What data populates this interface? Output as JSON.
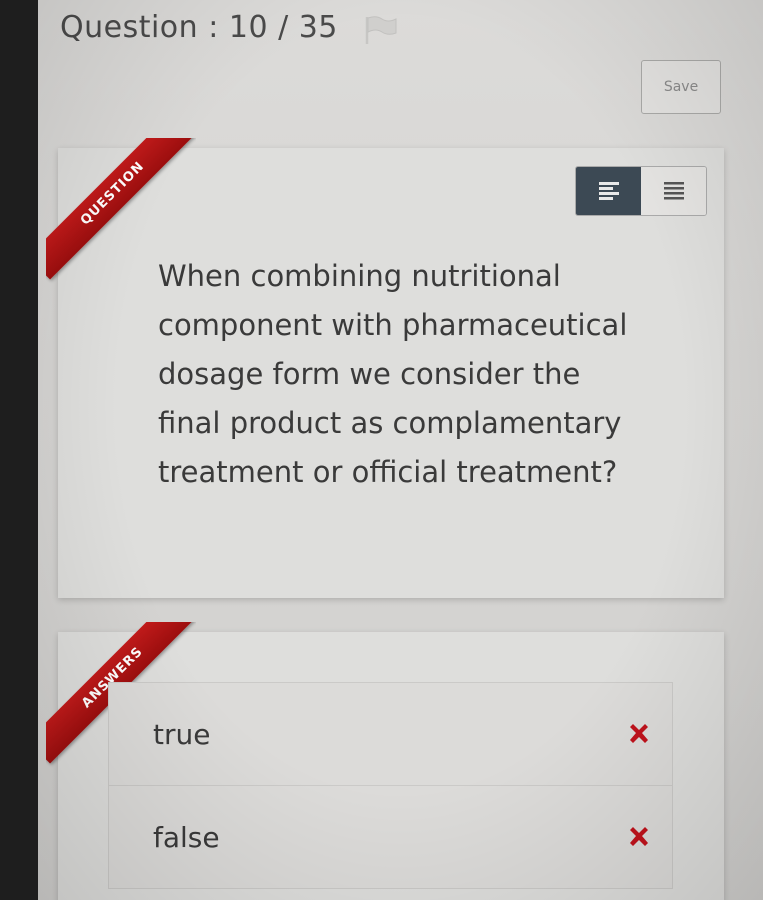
{
  "header": {
    "question_label": "Question : 10 / 35"
  },
  "toolbar": {
    "save_label": "Save"
  },
  "question_card": {
    "ribbon_label": "QUESTION",
    "text": "When combining nutritional component with pharmaceutical dosage form we consider the final product as complamentary treatment or official treatment?",
    "align_toggle": {
      "active": "align-left",
      "options": [
        "align-left-icon",
        "align-justify-icon"
      ]
    }
  },
  "answers_card": {
    "ribbon_label": "ANSWERS",
    "items": [
      {
        "label": "true",
        "icon": "cross-icon"
      },
      {
        "label": "false",
        "icon": "cross-icon"
      }
    ]
  },
  "colors": {
    "ribbon": "#b01414",
    "cross": "#c0121c",
    "toggle_active": "#3c4954"
  }
}
